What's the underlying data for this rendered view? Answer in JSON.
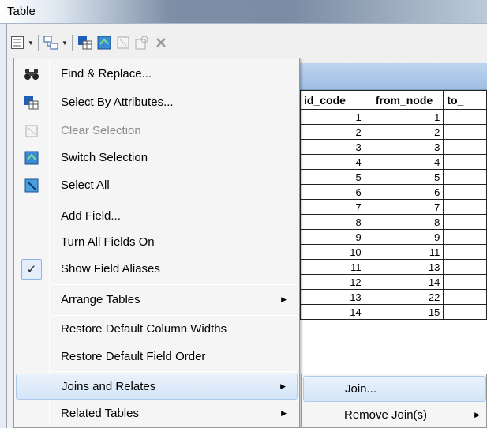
{
  "window": {
    "title": "Table"
  },
  "toolbar": {
    "icons": [
      "table-options-icon",
      "related-tables-icon",
      "select-by-attributes-icon",
      "switch-selection-icon",
      "clear-selection-icon",
      "zoom-to-selected-icon",
      "delete-selected-icon"
    ]
  },
  "table": {
    "columns": [
      "id_code",
      "from_node",
      "to_"
    ],
    "rows": [
      [
        "1",
        "1",
        ""
      ],
      [
        "2",
        "2",
        ""
      ],
      [
        "3",
        "3",
        ""
      ],
      [
        "4",
        "4",
        ""
      ],
      [
        "5",
        "5",
        ""
      ],
      [
        "6",
        "6",
        ""
      ],
      [
        "7",
        "7",
        ""
      ],
      [
        "8",
        "8",
        ""
      ],
      [
        "9",
        "9",
        ""
      ],
      [
        "10",
        "11",
        ""
      ],
      [
        "11",
        "13",
        ""
      ],
      [
        "12",
        "14",
        ""
      ],
      [
        "13",
        "22",
        ""
      ],
      [
        "14",
        "15",
        ""
      ]
    ]
  },
  "menu": {
    "items": [
      {
        "label": "Find & Replace...",
        "icon": "binoculars-icon"
      },
      {
        "label": "Select By Attributes...",
        "icon": "select-by-attributes-icon"
      },
      {
        "label": "Clear Selection",
        "icon": "clear-selection-icon",
        "disabled": true
      },
      {
        "label": "Switch Selection",
        "icon": "switch-selection-icon"
      },
      {
        "label": "Select All",
        "icon": "select-all-icon"
      },
      {
        "label": "Add Field..."
      },
      {
        "label": "Turn All Fields On"
      },
      {
        "label": "Show Field Aliases",
        "checked": true
      },
      {
        "label": "Arrange Tables",
        "submenu": true
      },
      {
        "label": "Restore Default Column Widths"
      },
      {
        "label": "Restore Default Field Order"
      },
      {
        "label": "Joins and Relates",
        "submenu": true,
        "highlighted": true
      },
      {
        "label": "Related Tables",
        "submenu": true
      }
    ]
  },
  "submenu": {
    "items": [
      {
        "label": "Join...",
        "highlighted": true
      },
      {
        "label": "Remove Join(s)",
        "submenu": true
      }
    ]
  },
  "colors": {
    "highlight": "#d4e5f8",
    "menu_bg": "#f5f5f5",
    "header_band": "#a9c6e8"
  }
}
